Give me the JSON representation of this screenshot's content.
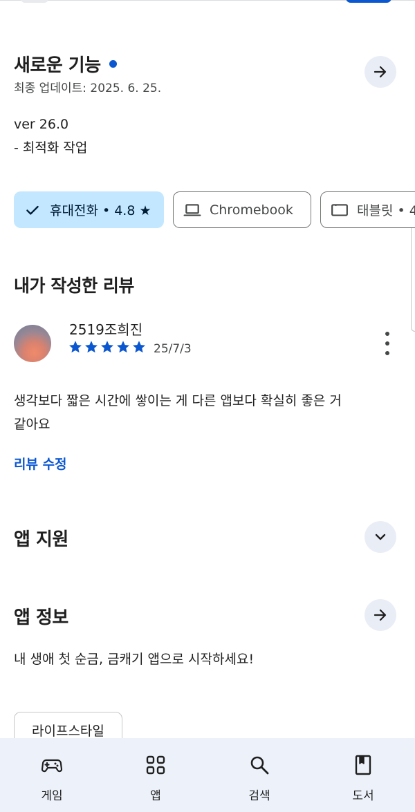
{
  "whats_new": {
    "title": "새로운 기능",
    "last_updated": "최종 업데이트: 2025. 6. 25.",
    "version": "ver 26.0",
    "notes": "- 최적화 작업"
  },
  "device_chips": [
    {
      "label": "휴대전화 • 4.8 ★",
      "icon": "check-icon",
      "selected": true
    },
    {
      "label": "Chromebook",
      "icon": "laptop-icon",
      "selected": false
    },
    {
      "label": "태블릿 • 4",
      "icon": "tablet-icon",
      "selected": false
    }
  ],
  "my_review": {
    "title": "내가 작성한 리뷰",
    "reviewer": "2519조희진",
    "rating": 5,
    "date": "25/7/3",
    "text_line1": "생각보다 짧은 시간에 쌓이는 게 다른 앱보다 확실히 좋은 거",
    "text_line2": "같아요",
    "edit_label": "리뷰 수정"
  },
  "app_support": {
    "title": "앱 지원"
  },
  "app_info": {
    "title": "앱 정보",
    "description": "내 생애 첫 순금, 금캐기 앱으로 시작하세요!",
    "category": "라이프스타일"
  },
  "bottom_nav": [
    {
      "label": "게임",
      "icon": "gamepad-icon"
    },
    {
      "label": "앱",
      "icon": "apps-grid-icon"
    },
    {
      "label": "검색",
      "icon": "search-icon"
    },
    {
      "label": "도서",
      "icon": "book-icon"
    }
  ],
  "colors": {
    "accent": "#0b57d0",
    "selected_chip": "#c2e7ff",
    "nav_background": "#edf2fa",
    "circle_button": "#e9edf6"
  }
}
